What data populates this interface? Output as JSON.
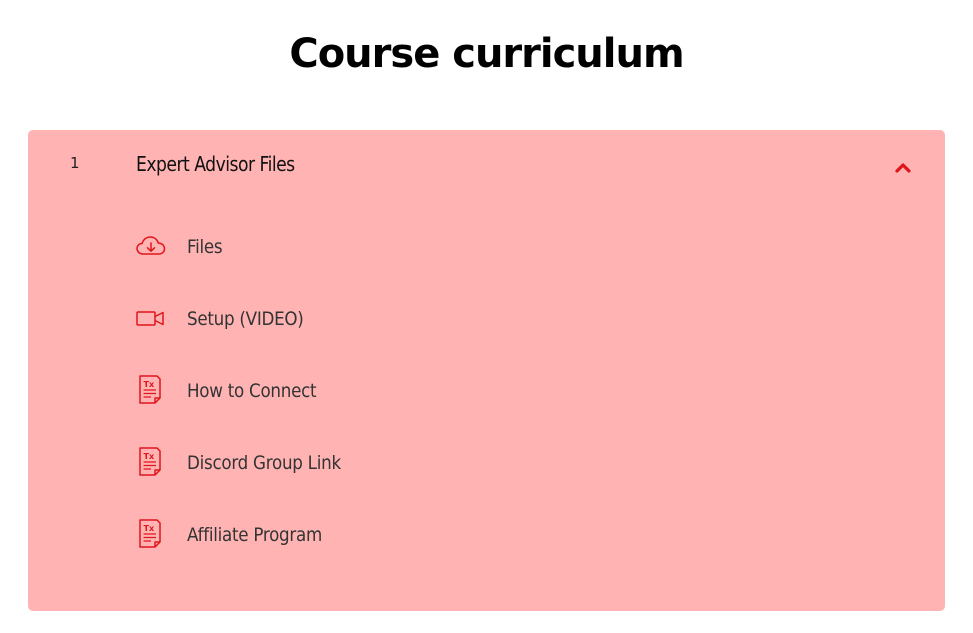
{
  "page": {
    "title": "Course curriculum"
  },
  "colors": {
    "accent": "#e0151c",
    "card_background": "#ffb3b3"
  },
  "section": {
    "number": "1",
    "title": "Expert Advisor Files",
    "expanded": true,
    "toggle_icon": "chevron-up-icon",
    "lessons": [
      {
        "label": "Files",
        "icon": "cloud-download-icon"
      },
      {
        "label": "Setup (VIDEO)",
        "icon": "video-camera-icon"
      },
      {
        "label": "How to Connect",
        "icon": "text-document-icon"
      },
      {
        "label": "Discord Group Link",
        "icon": "text-document-icon"
      },
      {
        "label": "Affiliate Program",
        "icon": "text-document-icon"
      }
    ]
  }
}
